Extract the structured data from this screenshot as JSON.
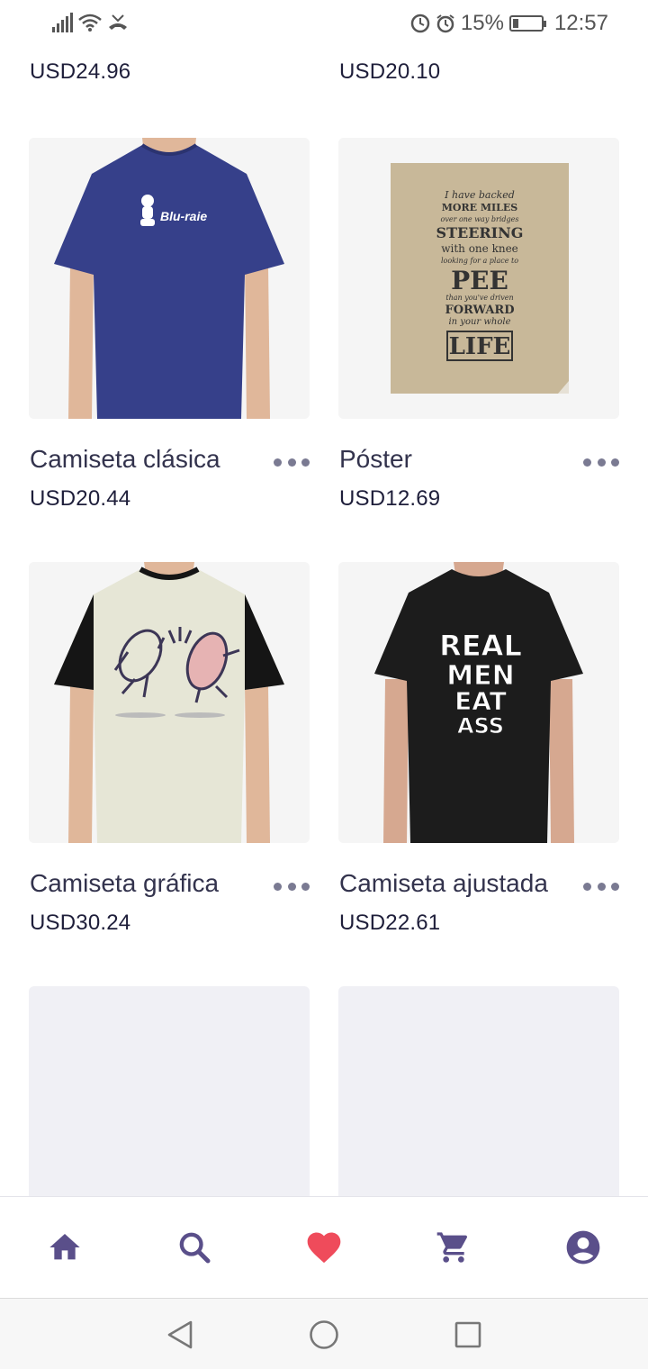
{
  "status_bar": {
    "battery_percent": "15%",
    "time": "12:57"
  },
  "top_row": {
    "left_price": "USD24.96",
    "right_price": "USD20.10"
  },
  "products": [
    {
      "title": "Camiseta clásica",
      "price": "USD20.44",
      "image_label": "Blu-raie",
      "shirt_color": "#36408a"
    },
    {
      "title": "Póster",
      "price": "USD12.69",
      "image_label": [
        "I have backed",
        "MORE MILES",
        "over one way bridges",
        "STEERING",
        "with one knee",
        "looking for a place to",
        "PEE",
        "than you've driven",
        "FORWARD",
        "in your whole",
        "LIFE"
      ]
    },
    {
      "title": "Camiseta gráfica",
      "price": "USD30.24",
      "shirt_color": "#e6e6d6"
    },
    {
      "title": "Camiseta ajustada",
      "price": "USD22.61",
      "image_label": [
        "REAL",
        "MEN",
        "EAT",
        "ASS"
      ],
      "shirt_color": "#1c1c1c"
    }
  ],
  "nav": {
    "items": [
      "home-icon",
      "search-icon",
      "heart-icon",
      "cart-icon",
      "account-icon"
    ],
    "colors": {
      "default": "#5a4f8a",
      "active": "#ef4b5b"
    }
  }
}
